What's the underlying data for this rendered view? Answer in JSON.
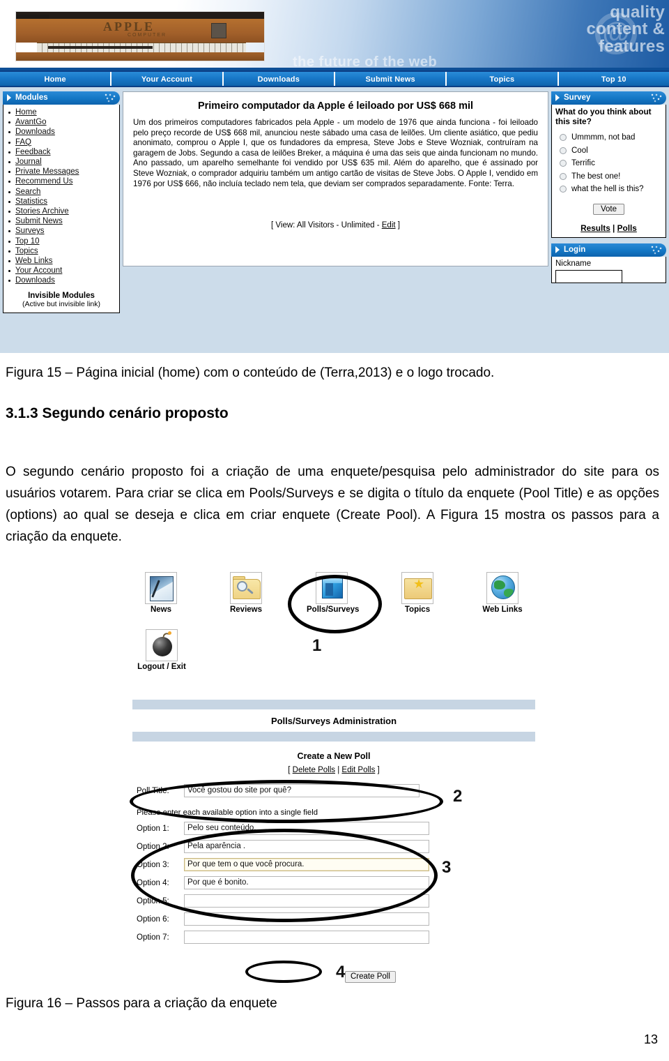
{
  "figure15": {
    "banner": {
      "tagline": "the future of the web",
      "quality_line1": "quality",
      "quality_line2": "content &",
      "quality_line3": "features",
      "logo_glyph": "@",
      "photo_label": "APPLE",
      "photo_sub": "COMPUTER"
    },
    "nav": [
      "Home",
      "Your Account",
      "Downloads",
      "Submit News",
      "Topics",
      "Top 10"
    ],
    "modules": {
      "header": "Modules",
      "items": [
        "Home",
        "AvantGo",
        "Downloads",
        "FAQ",
        "Feedback",
        "Journal",
        "Private Messages",
        "Recommend Us",
        "Search",
        "Statistics",
        "Stories Archive",
        "Submit News",
        "Surveys",
        "Top 10",
        "Topics",
        "Web Links",
        "Your Account",
        "Downloads"
      ],
      "invisible_title": "Invisible Modules",
      "invisible_sub": "(Active but invisible link)"
    },
    "article": {
      "title": "Primeiro computador da Apple é leiloado por US$ 668 mil",
      "body": "Um dos primeiros computadores fabricados pela Apple - um modelo de 1976 que ainda funciona - foi leiloado pelo preço recorde de US$ 668 mil, anunciou neste sábado uma casa de leilões. Um cliente asiático, que pediu anonimato, comprou o Apple I, que os fundadores da empresa, Steve Jobs e Steve Wozniak, contruíram na garagem de Jobs. Segundo a casa de leilões Breker, a máquina é uma das seis que ainda funcionam no mundo. Ano passado, um aparelho semelhante foi vendido por US$ 635 mil. Além do aparelho, que é assinado por Steve Wozniak, o comprador adquiriu também um antigo cartão de visitas de Steve Jobs.   O Apple I, vendido em 1976 por US$ 666, não incluía teclado nem tela, que deviam ser comprados separadamente.      Fonte: Terra.",
      "view_prefix": "[ View: All Visitors - Unlimited - ",
      "view_link": "Edit",
      "view_suffix": " ]"
    },
    "survey": {
      "header": "Survey",
      "question": "What do you think about this site?",
      "options": [
        "Ummmm, not bad",
        "Cool",
        "Terrific",
        "The best one!",
        "what the hell is this?"
      ],
      "vote_button": "Vote",
      "results_link": "Results",
      "separator": " | ",
      "polls_link": "Polls"
    },
    "login": {
      "header": "Login",
      "nickname_label": "Nickname",
      "nickname_value": ""
    }
  },
  "doc": {
    "figure15_caption": "Figura 15 – Página inicial (home) com o conteúdo de (Terra,2013) e o logo trocado.",
    "section_heading": "3.1.3 Segundo cenário proposto",
    "paragraph": "O segundo cenário proposto foi a criação de uma enquete/pesquisa pelo administrador do site para os usuários votarem. Para criar se clica em Pools/Surveys e se digita o título da enquete (Pool Title) e as opções (options) ao qual se deseja e clica em criar enquete (Create Pool). A Figura 15 mostra os passos para a criação da enquete.",
    "figure16_caption": "Figura 16 – Passos para a criação da enquete",
    "page_number": "13"
  },
  "figure16": {
    "icons_row1": [
      {
        "label": "News",
        "icon": "news-icon"
      },
      {
        "label": "Reviews",
        "icon": "reviews-icon"
      },
      {
        "label": "Polls/Surveys",
        "icon": "polls-surveys-icon"
      },
      {
        "label": "Topics",
        "icon": "topics-icon"
      },
      {
        "label": "Web Links",
        "icon": "web-links-icon"
      }
    ],
    "icons_row2": [
      {
        "label": "Logout / Exit",
        "icon": "logout-icon"
      }
    ],
    "markers": [
      "1",
      "2",
      "3",
      "4"
    ],
    "admin": {
      "title": "Polls/Surveys Administration",
      "create_heading": "Create a New Poll",
      "links_prefix": "[ ",
      "delete_link": "Delete Polls",
      "links_sep": " | ",
      "edit_link": "Edit Polls",
      "links_suffix": " ]",
      "poll_title_label": "Poll Title:",
      "poll_title_value": "Você gostou do site por quê?",
      "hint": "Please enter each available option into a single field",
      "options": [
        {
          "label": "Option 1:",
          "value": "Pelo seu conteúdo."
        },
        {
          "label": "Option 2:",
          "value": "Pela aparência ."
        },
        {
          "label": "Option 3:",
          "value": "Por que tem o que você procura."
        },
        {
          "label": "Option 4:",
          "value": "Por que é bonito."
        },
        {
          "label": "Option 5:",
          "value": ""
        },
        {
          "label": "Option 6:",
          "value": ""
        },
        {
          "label": "Option 7:",
          "value": ""
        }
      ],
      "create_button": "Create Poll"
    }
  }
}
